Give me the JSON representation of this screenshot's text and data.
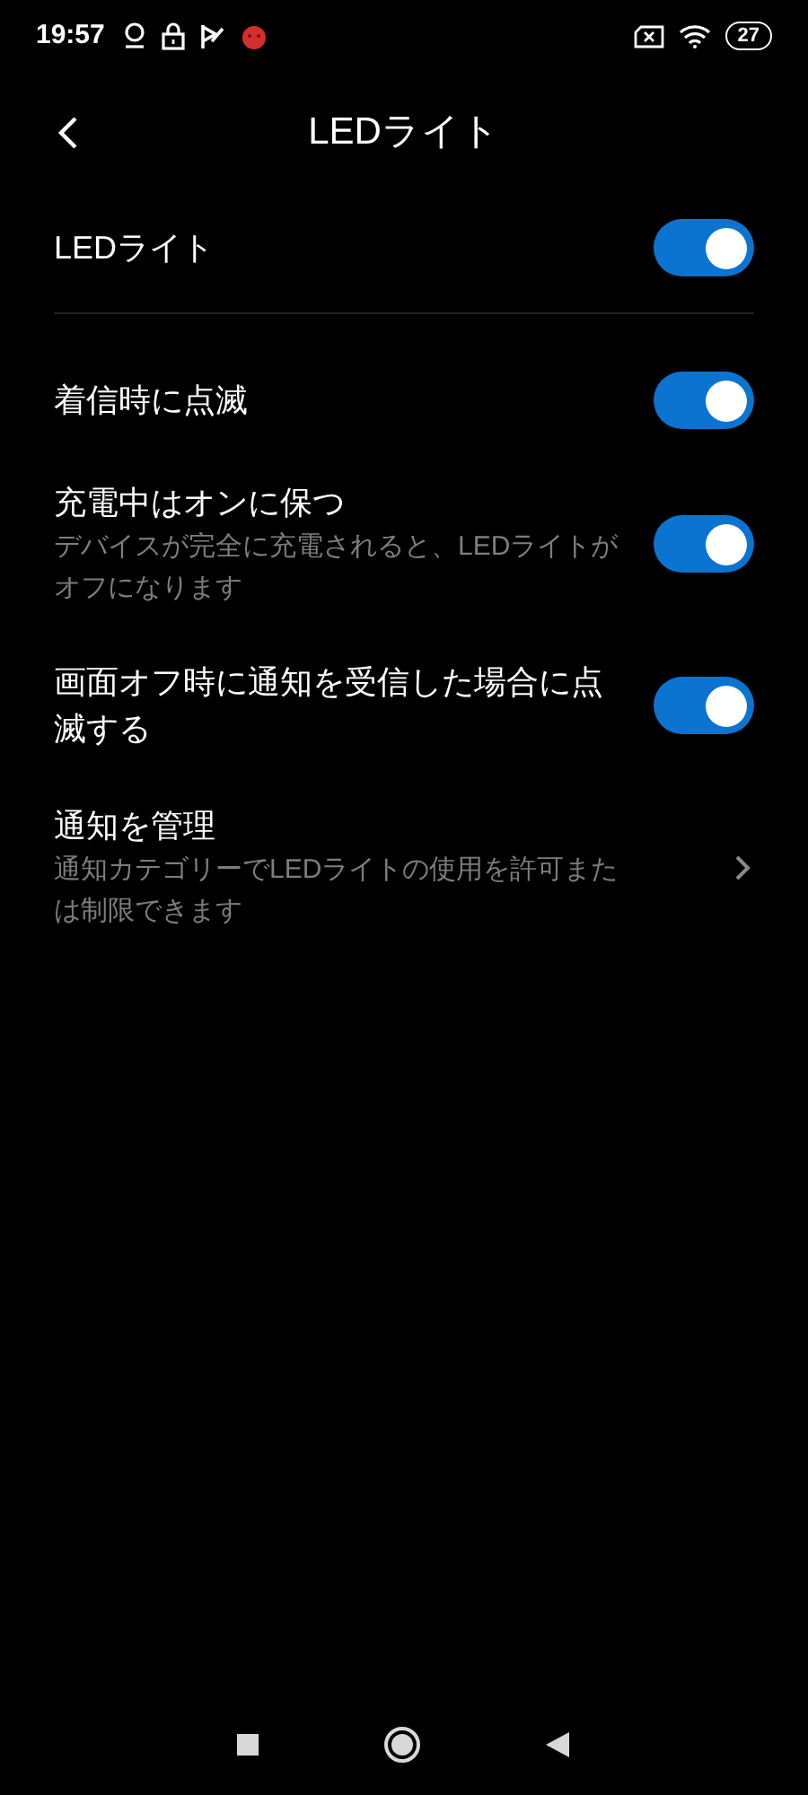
{
  "status_bar": {
    "time": "19:57",
    "battery": "27"
  },
  "header": {
    "title": "LEDライト"
  },
  "sections": [
    {
      "rows": [
        {
          "kind": "toggle",
          "title": "LEDライト",
          "on": true
        }
      ]
    },
    {
      "rows": [
        {
          "kind": "toggle",
          "title": "着信時に点滅",
          "on": true
        },
        {
          "kind": "toggle",
          "title": "充電中はオンに保つ",
          "subtitle": "デバイスが完全に充電されると、LEDライトがオフになります",
          "on": true
        },
        {
          "kind": "toggle",
          "title": "画面オフ時に通知を受信した場合に点滅する",
          "on": true
        },
        {
          "kind": "link",
          "title": "通知を管理",
          "subtitle": "通知カテゴリーでLEDライトの使用を許可または制限できます"
        }
      ]
    }
  ]
}
